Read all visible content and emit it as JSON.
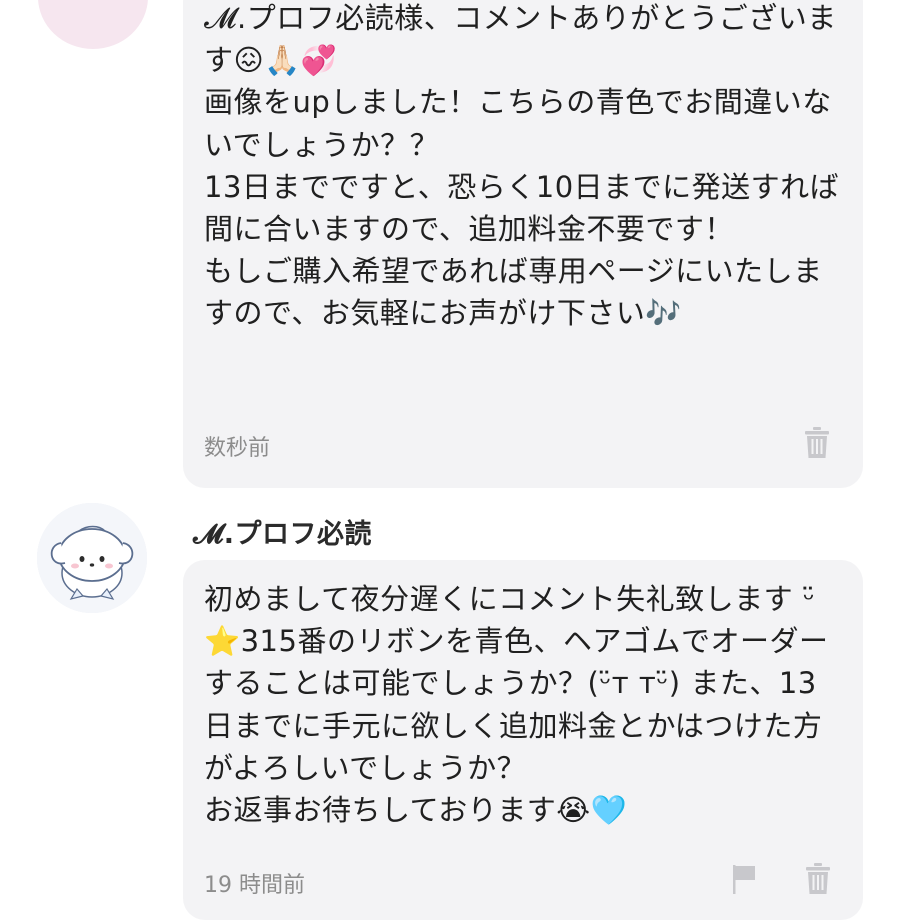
{
  "comments": [
    {
      "author": "",
      "message": "𝓜.プロフ必読様、コメントありがとうございます😖🙏🏻💞\n画像をupしました！こちらの青色でお間違いないでしょうか？？\n13日までですと、恐らく10日までに発送すれば間に合いますので、追加料金不要です！\nもしご購入希望であれば専用ページにいたしますので、お気軽にお声がけ下さい🎶",
      "time": "数秒前",
      "actions": [
        "trash-icon"
      ]
    },
    {
      "author": "𝓜.プロフ必読",
      "message": "初めまして夜分遅くにコメント失礼致します ᵕ̈ ⭐️315番のリボンを青色、ヘアゴムでオーダーすることは可能でしょうか？(ᵕ̈ᴛ ᴛᵕ̈) また、13日までに手元に欲しく追加料金とかはつけた方がよろしいでしょうか？\nお返事お待ちしております😭🩵",
      "time": "19 時間前",
      "actions": [
        "flag-icon",
        "trash-icon"
      ]
    }
  ],
  "colors": {
    "bubble": "#f3f3f5",
    "meta_text": "#8c8c8c",
    "icon": "#c8c8cc",
    "seller_avatar": "#f6e6ef"
  }
}
